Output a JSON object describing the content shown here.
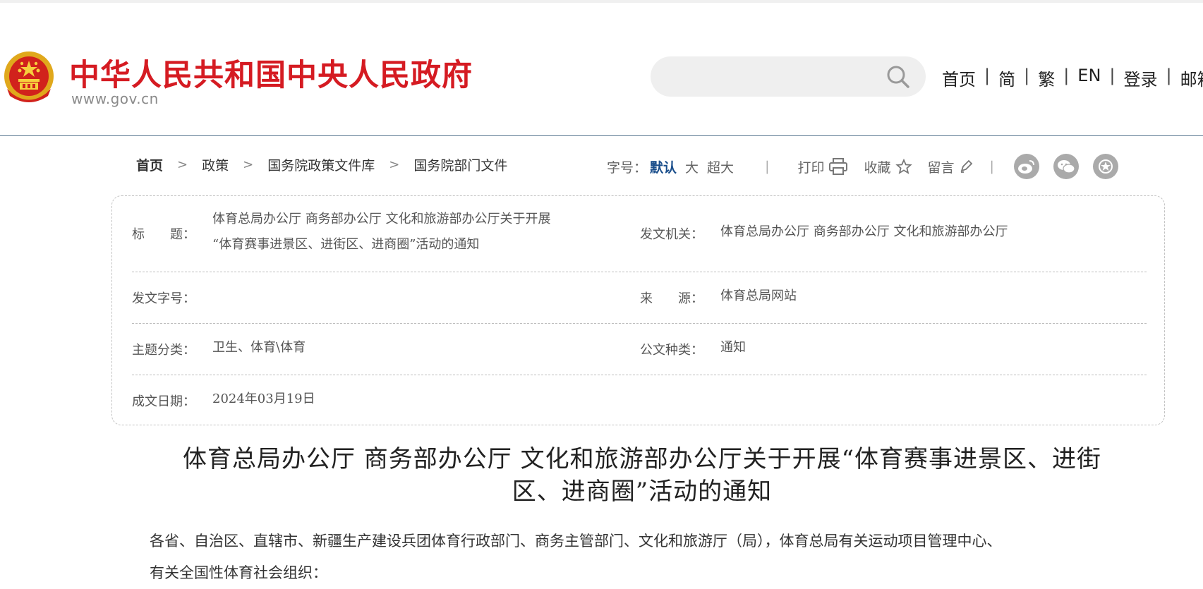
{
  "header": {
    "site_name": "中华人民共和国中央人民政府",
    "site_url": "www.gov.cn",
    "search_placeholder": "",
    "nav": [
      "首页",
      "简",
      "繁",
      "EN",
      "登录",
      "邮箱"
    ],
    "brand_color": "#d51b22"
  },
  "breadcrumb": [
    "首页",
    "政策",
    "国务院政策文件库",
    "国务院部门文件"
  ],
  "tools": {
    "font_size_label": "字号：",
    "font_sizes": [
      "默认",
      "大",
      "超大"
    ],
    "print": "打印",
    "favorite": "收藏",
    "comment": "留言",
    "share_icons": [
      "weibo-icon",
      "wechat-icon",
      "star-share-icon"
    ]
  },
  "info": {
    "title_label": "标　　题：",
    "title_value_line1": "体育总局办公厅  商务部办公厅  文化和旅游部办公厅关于开展",
    "title_value_line2": "“体育赛事进景区、进街区、进商圈”活动的通知",
    "issuer_label": "发文机关：",
    "issuer_value": "体育总局办公厅  商务部办公厅  文化和旅游部办公厅",
    "doc_no_label": "发文字号：",
    "doc_no_value": "",
    "source_label": "来　　源：",
    "source_value": "体育总局网站",
    "topic_label": "主题分类：",
    "topic_value": "卫生、体育\\体育",
    "doc_type_label": "公文种类：",
    "doc_type_value": "通知",
    "date_label": "成文日期：",
    "date_value": "2024年03月19日"
  },
  "article": {
    "title_line1": "体育总局办公厅  商务部办公厅  文化和旅游部办公厅关于开展“体育赛事进景区、进街",
    "title_line2": "区、进商圈”活动的通知",
    "body_line1": "各省、自治区、直辖市、新疆生产建设兵团体育行政部门、商务主管部门、文化和旅游厅（局），体育总局有关运动项目管理中心、",
    "body_line2": "有关全国性体育社会组织："
  }
}
